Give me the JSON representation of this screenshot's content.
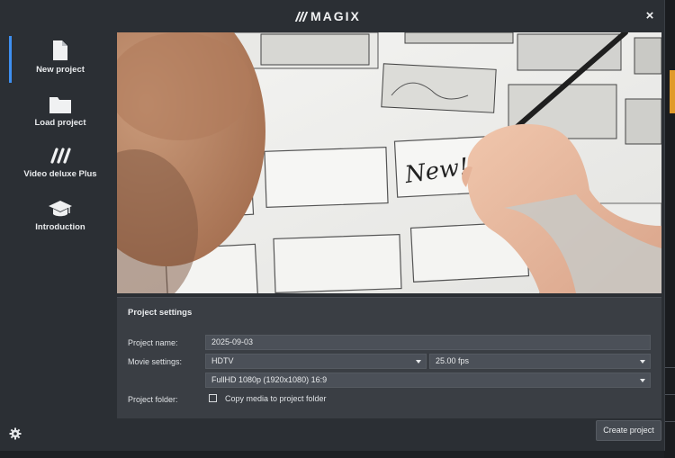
{
  "app": {
    "logo_text": "MAGIX",
    "close_label": "×"
  },
  "sidebar": {
    "items": [
      {
        "label": "New project",
        "icon": "new-file-icon",
        "active": true
      },
      {
        "label": "Load project",
        "icon": "folder-icon",
        "active": false
      },
      {
        "label": "Video deluxe Plus",
        "icon": "magix-slashes-icon",
        "active": false
      },
      {
        "label": "Introduction",
        "icon": "graduation-cap-icon",
        "active": false
      }
    ],
    "settings_icon": "gear-icon"
  },
  "hero": {
    "handwritten_text": "New!"
  },
  "settings": {
    "title": "Project settings",
    "project_name_label": "Project name:",
    "project_name_value": "2025-09-03",
    "movie_settings_label": "Movie settings:",
    "movie_format": "HDTV",
    "frame_rate": "25.00 fps",
    "resolution": "FullHD 1080p (1920x1080) 16:9",
    "project_folder_label": "Project folder:",
    "copy_media_label": "Copy media to project folder",
    "copy_media_checked": false
  },
  "footer": {
    "create_label": "Create project"
  },
  "colors": {
    "accent": "#3e8ff0",
    "panel": "#3a3e44",
    "background": "#2b2f34"
  }
}
